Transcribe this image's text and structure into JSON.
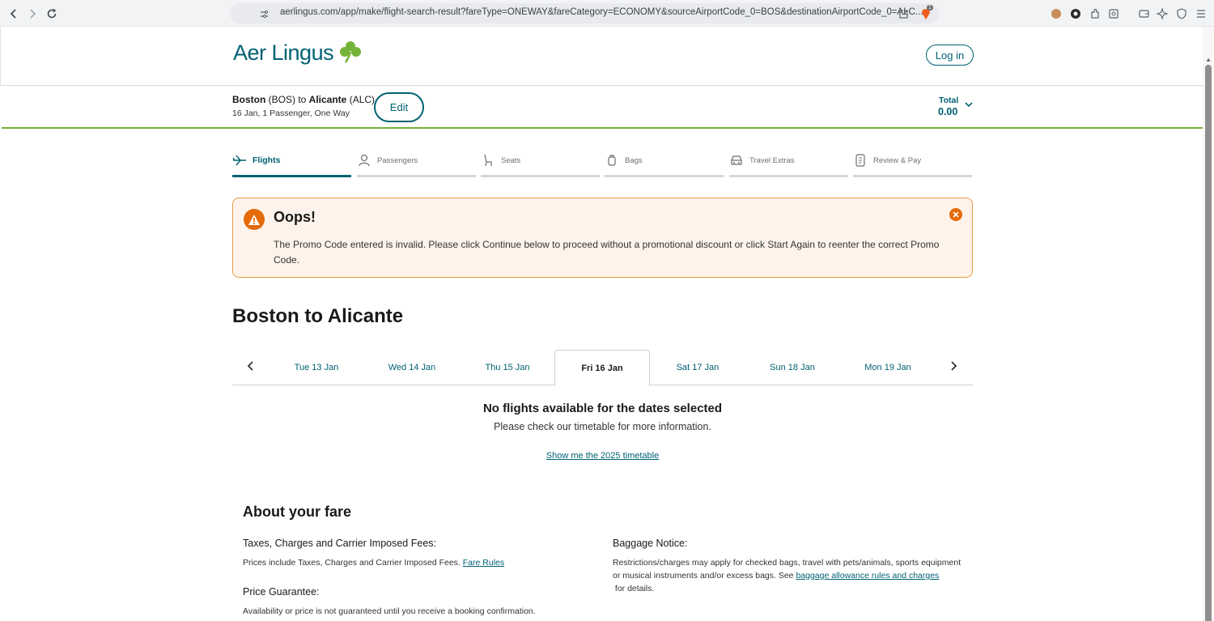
{
  "browser": {
    "url": "aerlingus.com/app/make/flight-search-result?fareType=ONEWAY&fareCategory=ECONOMY&sourceAirportCode_0=BOS&destinationAirportCode_0=ALC...",
    "shield_badge": "1"
  },
  "header": {
    "logo_text": "Aer Lingus",
    "login_label": "Log in",
    "brand_color": "#006272",
    "shamrock_color": "#75b43a"
  },
  "summary": {
    "origin_city": "Boston",
    "origin_code": " (BOS) to ",
    "destination_city": "Alicante",
    "destination_code": " (ALC)",
    "details": "16 Jan, 1 Passenger, One Way",
    "edit_label": "Edit",
    "total_label": "Total",
    "total_value": "0.00"
  },
  "steps": [
    {
      "label": "Flights",
      "icon": "plane-icon",
      "active": true
    },
    {
      "label": "Passengers",
      "icon": "person-icon",
      "active": false
    },
    {
      "label": "Seats",
      "icon": "seat-icon",
      "active": false
    },
    {
      "label": "Bags",
      "icon": "bag-icon",
      "active": false
    },
    {
      "label": "Travel Extras",
      "icon": "car-icon",
      "active": false
    },
    {
      "label": "Review & Pay",
      "icon": "receipt-icon",
      "active": false
    }
  ],
  "alert": {
    "title": "Oops!",
    "message": "The Promo Code entered is invalid. Please click Continue below to proceed without a promotional discount or click Start Again to reenter the correct Promo Code.",
    "color": "#e56a0a"
  },
  "page_title": "Boston to Alicante",
  "dates": [
    {
      "label": "Tue 13 Jan",
      "active": false
    },
    {
      "label": "Wed 14 Jan",
      "active": false
    },
    {
      "label": "Thu 15 Jan",
      "active": false
    },
    {
      "label": "Fri 16 Jan",
      "active": true
    },
    {
      "label": "Sat 17 Jan",
      "active": false
    },
    {
      "label": "Sun 18 Jan",
      "active": false
    },
    {
      "label": "Mon 19 Jan",
      "active": false
    }
  ],
  "no_flights": {
    "title": "No flights available for the dates selected",
    "subtitle": "Please check our timetable for more information.",
    "link": "Show me the 2025 timetable"
  },
  "about": {
    "title": "About your fare",
    "taxes_heading": "Taxes, Charges and Carrier Imposed Fees:",
    "taxes_text": "Prices include Taxes, Charges and Carrier Imposed Fees. ",
    "fare_rules_link": "Fare Rules",
    "price_heading": "Price Guarantee:",
    "price_text": "Availability or price is not guaranteed until you receive a booking confirmation.",
    "baggage_heading": "Baggage Notice:",
    "baggage_text": "Restrictions/charges may apply for checked bags, travel with pets/animals, sports equipment or musical instruments and/or excess bags. See ",
    "baggage_link": "baggage allowance rules and charges",
    "baggage_suffix": " for details."
  }
}
